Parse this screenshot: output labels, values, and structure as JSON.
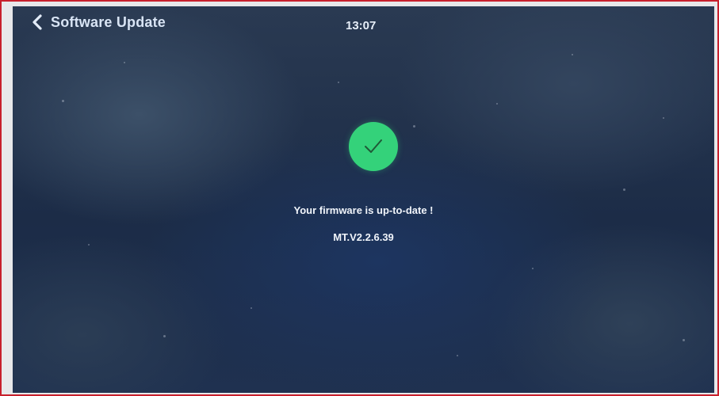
{
  "header": {
    "title": "Software Update",
    "back_icon": "chevron-left-icon",
    "time": "13:07"
  },
  "status": {
    "icon": "checkmark-icon",
    "icon_color": "#34d27a",
    "message": "Your firmware is up-to-date !",
    "version": "MT.V2.2.6.39"
  }
}
